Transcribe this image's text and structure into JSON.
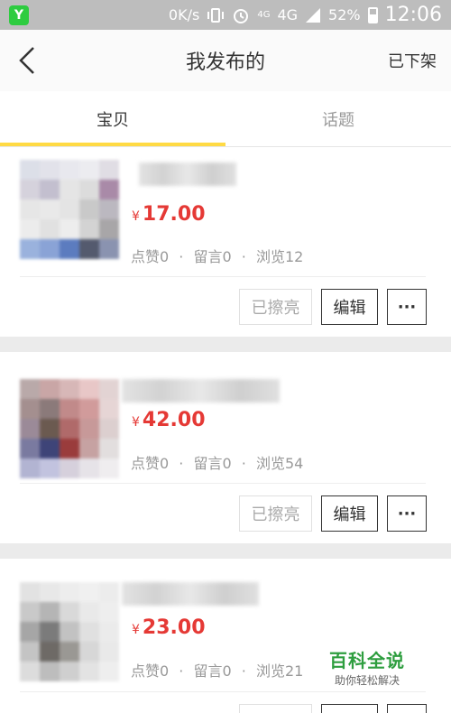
{
  "status_bar": {
    "app_glyph": "Y",
    "network_speed": "0K/s",
    "signal_label_small": "4G",
    "signal_label": "4G",
    "battery": "52%",
    "time": "12:06"
  },
  "nav": {
    "title": "我发布的",
    "action": "已下架"
  },
  "tabs": [
    {
      "label": "宝贝",
      "active": true
    },
    {
      "label": "话题",
      "active": false
    }
  ],
  "items": [
    {
      "currency": "¥",
      "price": "17.00",
      "likes": "点赞0",
      "comments": "留言0",
      "views": "浏览12",
      "sep": "·"
    },
    {
      "currency": "¥",
      "price": "42.00",
      "likes": "点赞0",
      "comments": "留言0",
      "views": "浏览54",
      "sep": "·"
    },
    {
      "currency": "¥",
      "price": "23.00",
      "likes": "点赞0",
      "comments": "留言0",
      "views": "浏览21",
      "sep": "·"
    }
  ],
  "buttons": {
    "polish": "已擦亮",
    "edit": "编辑",
    "more": "···"
  },
  "watermark": {
    "title": "百科全说",
    "subtitle": "助你轻松解决"
  },
  "colors": {
    "accent": "#ffda44",
    "price": "#e53935",
    "watermark": "#2e9e3f"
  }
}
